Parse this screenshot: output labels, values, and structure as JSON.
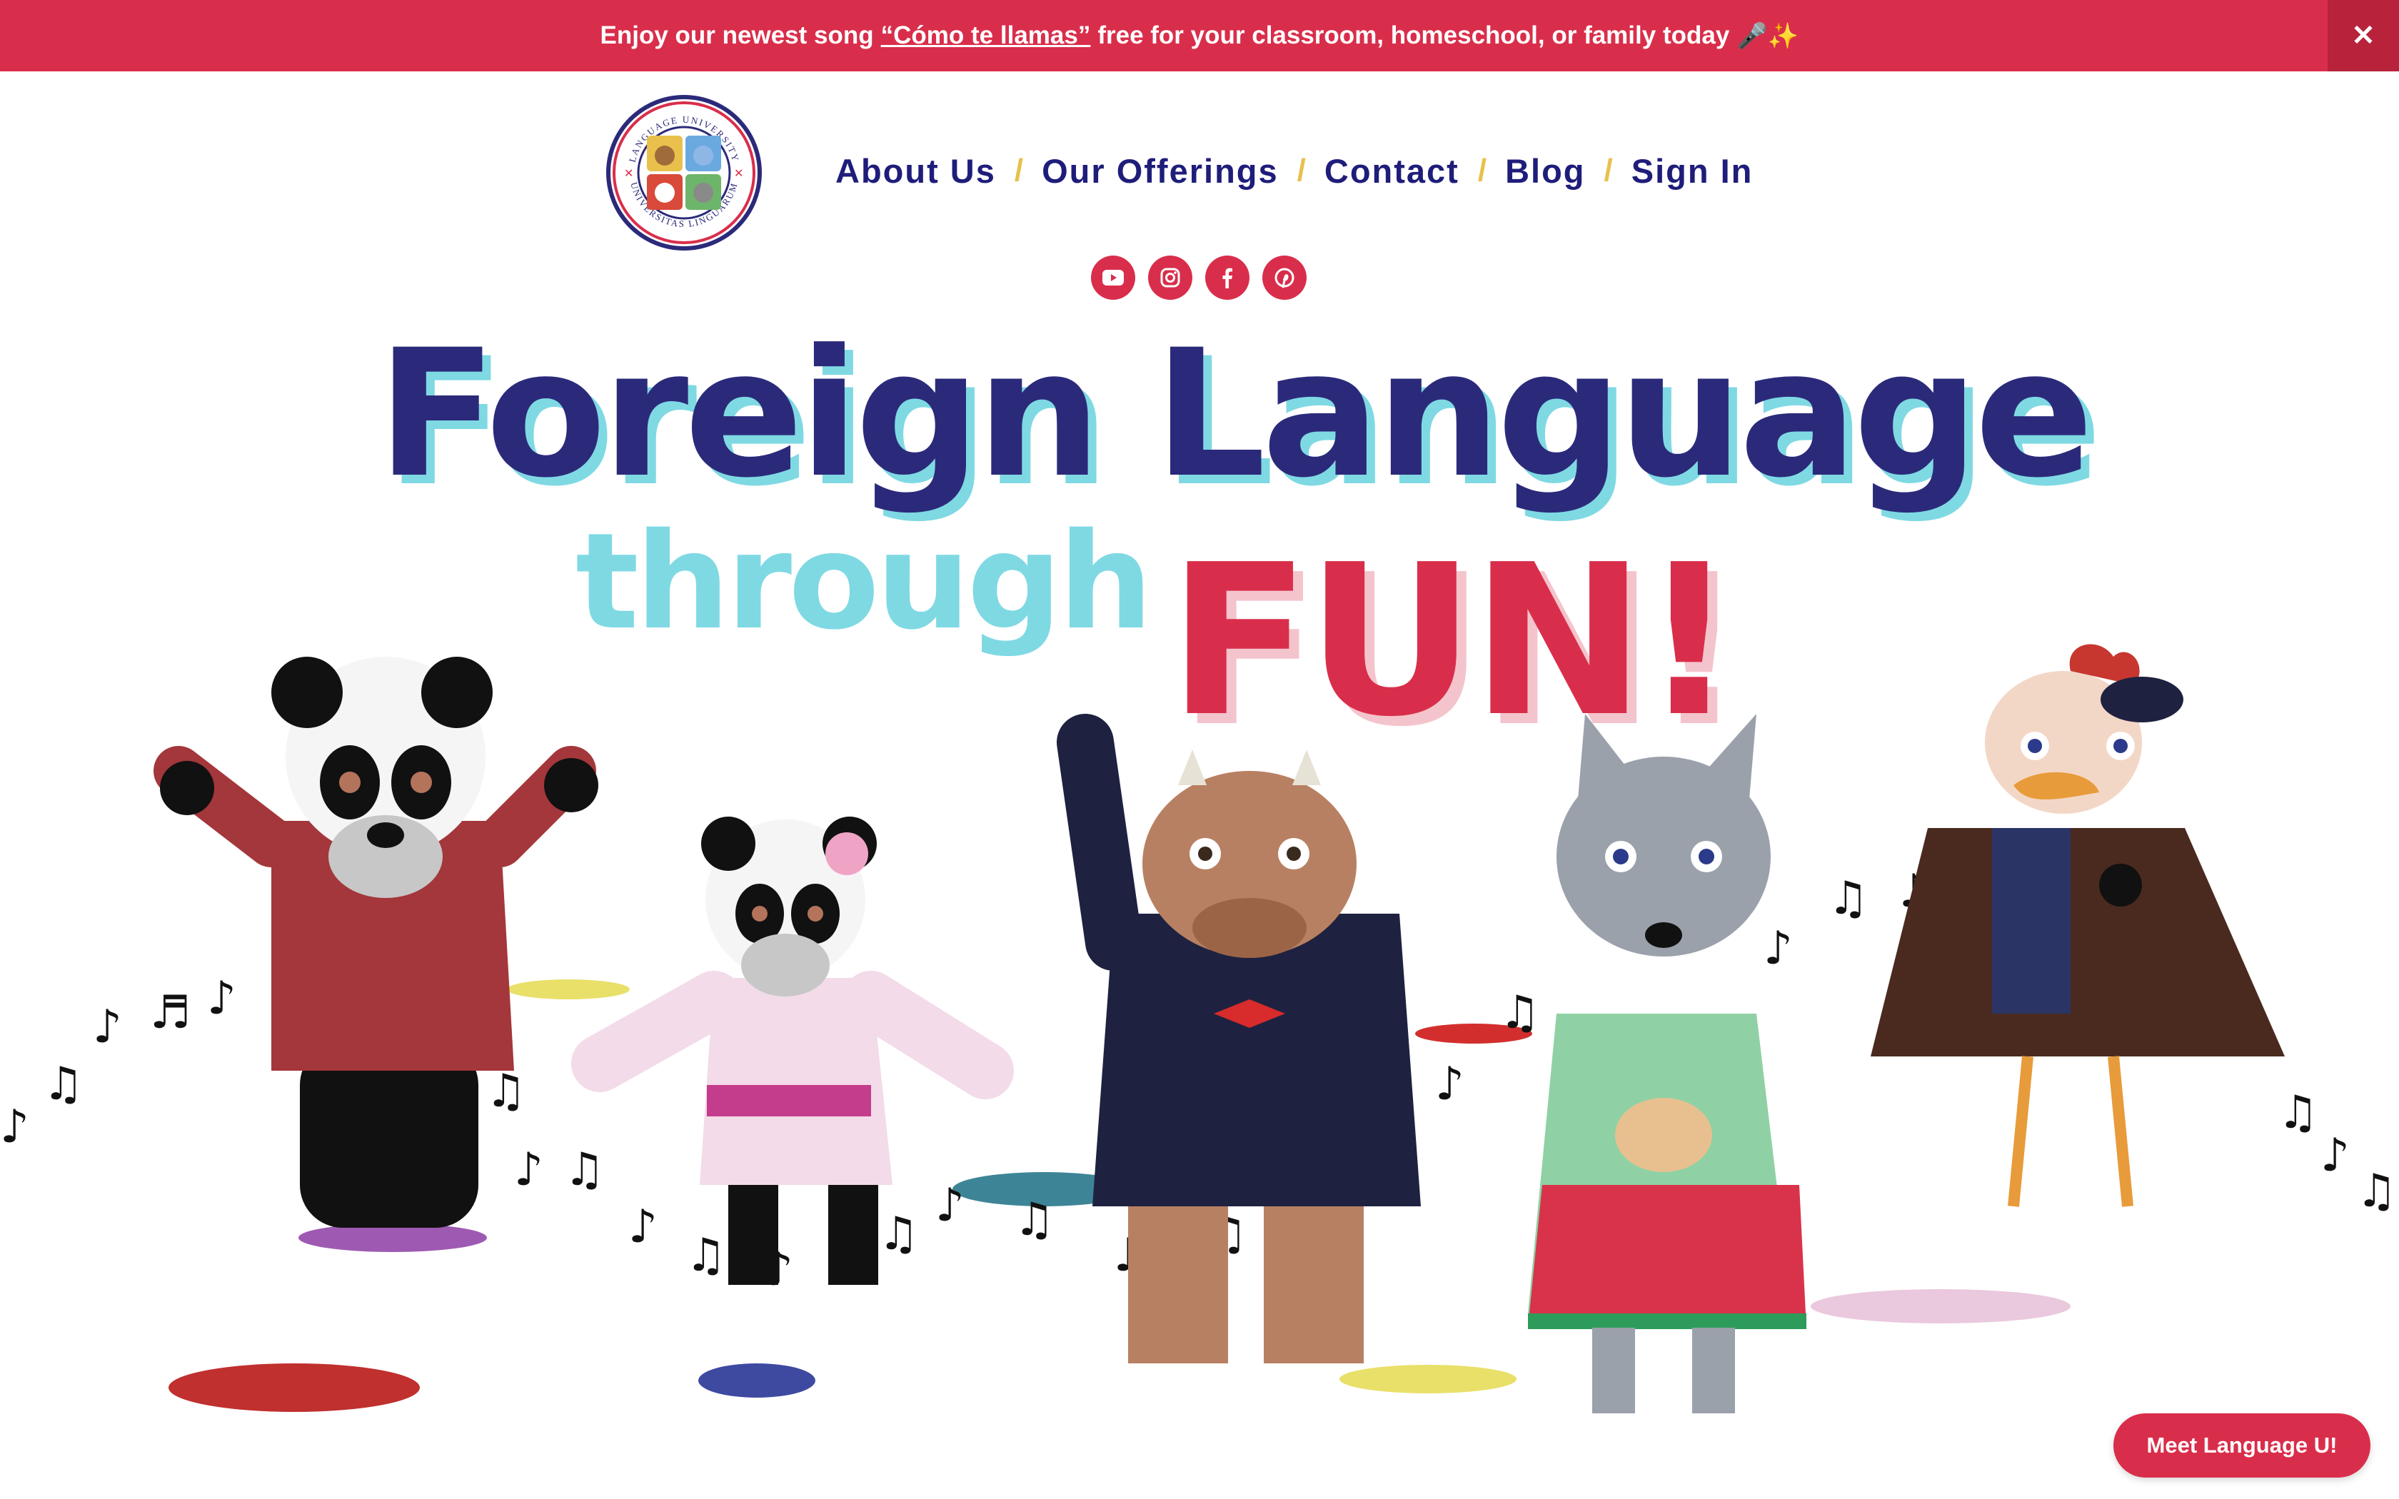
{
  "announcement": {
    "prefix": "Enjoy our newest song",
    "link": "“Cómo te llamas”",
    "suffix": "free for your classroom, homeschool, or family today",
    "emoji": "🎤✨",
    "close_icon": "close-icon"
  },
  "logo": {
    "top_text": "LANGUAGE UNIVERSITY",
    "bottom_text": "UNIVERSITAS LINGUARUM"
  },
  "nav": {
    "items": [
      {
        "label": "About Us"
      },
      {
        "label": "Our Offerings"
      },
      {
        "label": "Contact"
      },
      {
        "label": "Blog"
      },
      {
        "label": "Sign In"
      }
    ],
    "separator": "/"
  },
  "socials": [
    "youtube-icon",
    "instagram-icon",
    "facebook-icon",
    "pinterest-icon"
  ],
  "hero": {
    "line1": "Foreign Language",
    "line2": "through",
    "line3": "FUN!"
  },
  "floating_button": {
    "label": "Meet Language U!"
  },
  "colors": {
    "brand_red": "#d92e4b",
    "navy": "#2b2a7a",
    "cyan": "#7fd9e3",
    "separator_gold": "#e8c04b"
  }
}
